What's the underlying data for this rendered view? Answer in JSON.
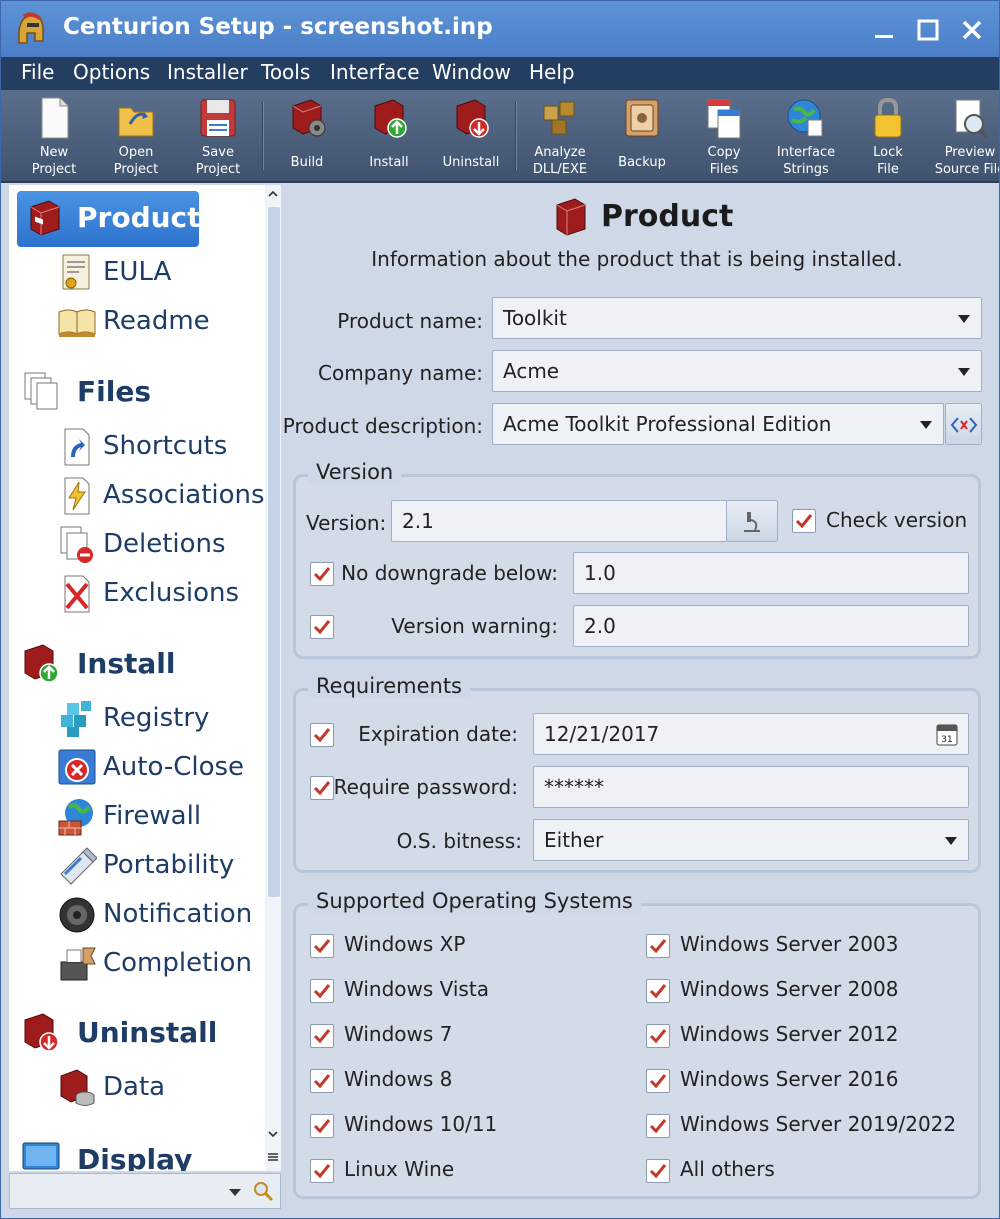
{
  "window": {
    "title": "Centurion Setup - screenshot.inp"
  },
  "menu": [
    "File",
    "Options",
    "Installer",
    "Tools",
    "Interface",
    "Window",
    "Help"
  ],
  "toolbar": [
    {
      "label": "New\nProject",
      "icon": "new-project-icon"
    },
    {
      "label": "Open\nProject",
      "icon": "open-project-icon"
    },
    {
      "label": "Save\nProject",
      "icon": "save-project-icon"
    },
    {
      "label": "Build",
      "icon": "build-icon"
    },
    {
      "label": "Install",
      "icon": "install-icon"
    },
    {
      "label": "Uninstall",
      "icon": "uninstall-icon"
    },
    {
      "label": "Analyze\nDLL/EXE",
      "icon": "analyze-icon"
    },
    {
      "label": "Backup",
      "icon": "backup-icon"
    },
    {
      "label": "Copy\nFiles",
      "icon": "copy-files-icon"
    },
    {
      "label": "Interface\nStrings",
      "icon": "interface-strings-icon"
    },
    {
      "label": "Lock\nFile",
      "icon": "lock-file-icon"
    },
    {
      "label": "Preview\nSource File",
      "icon": "preview-source-icon"
    }
  ],
  "sidebar": {
    "items": [
      {
        "label": "Product",
        "type": "category",
        "selected": true,
        "icon": "product-box-icon"
      },
      {
        "label": "EULA",
        "type": "child",
        "icon": "certificate-icon"
      },
      {
        "label": "Readme",
        "type": "child",
        "icon": "book-icon"
      },
      {
        "label": "Files",
        "type": "category",
        "icon": "files-icon"
      },
      {
        "label": "Shortcuts",
        "type": "child",
        "icon": "shortcut-icon"
      },
      {
        "label": "Associations",
        "type": "child",
        "icon": "lightning-file-icon"
      },
      {
        "label": "Deletions",
        "type": "child",
        "icon": "delete-file-icon"
      },
      {
        "label": "Exclusions",
        "type": "child",
        "icon": "exclusion-icon"
      },
      {
        "label": "Install",
        "type": "category",
        "icon": "install-box-icon"
      },
      {
        "label": "Registry",
        "type": "child",
        "icon": "registry-icon"
      },
      {
        "label": "Auto-Close",
        "type": "child",
        "icon": "auto-close-icon"
      },
      {
        "label": "Firewall",
        "type": "child",
        "icon": "firewall-icon"
      },
      {
        "label": "Portability",
        "type": "child",
        "icon": "usb-drive-icon"
      },
      {
        "label": "Notification",
        "type": "child",
        "icon": "speaker-icon"
      },
      {
        "label": "Completion",
        "type": "child",
        "icon": "completion-icon"
      },
      {
        "label": "Uninstall",
        "type": "category",
        "icon": "uninstall-box-icon"
      },
      {
        "label": "Data",
        "type": "child",
        "icon": "data-icon"
      },
      {
        "label": "Display",
        "type": "category",
        "icon": "display-icon"
      }
    ]
  },
  "page": {
    "title": "Product",
    "subtitle": "Information about the product that is being installed."
  },
  "fields": {
    "product_name": {
      "label": "Product name:",
      "value": "Toolkit"
    },
    "company_name": {
      "label": "Company name:",
      "value": "Acme"
    },
    "product_description": {
      "label": "Product description:",
      "value": "Acme Toolkit Professional Edition"
    }
  },
  "version_group": {
    "title": "Version",
    "version_label": "Version:",
    "version_value": "2.1",
    "check_version": {
      "label": "Check version",
      "checked": true
    },
    "no_downgrade": {
      "label": "No downgrade below:",
      "checked": true,
      "value": "1.0"
    },
    "version_warning": {
      "label": "Version warning:",
      "checked": true,
      "value": "2.0"
    }
  },
  "requirements_group": {
    "title": "Requirements",
    "expiration": {
      "label": "Expiration date:",
      "checked": true,
      "value": "12/21/2017"
    },
    "password": {
      "label": "Require password:",
      "checked": true,
      "value": "******"
    },
    "bitness": {
      "label": "O.S. bitness:",
      "value": "Either"
    }
  },
  "os_group": {
    "title": "Supported Operating Systems",
    "left": [
      "Windows XP",
      "Windows Vista",
      "Windows 7",
      "Windows 8",
      "Windows 10/11",
      "Linux Wine"
    ],
    "right": [
      "Windows Server 2003",
      "Windows Server 2008",
      "Windows Server 2012",
      "Windows Server 2016",
      "Windows Server 2019/2022",
      "All others"
    ]
  },
  "colors": {
    "accent": "#2d73cd",
    "check": "#c0392b",
    "nav_text": "#1d3d66"
  }
}
